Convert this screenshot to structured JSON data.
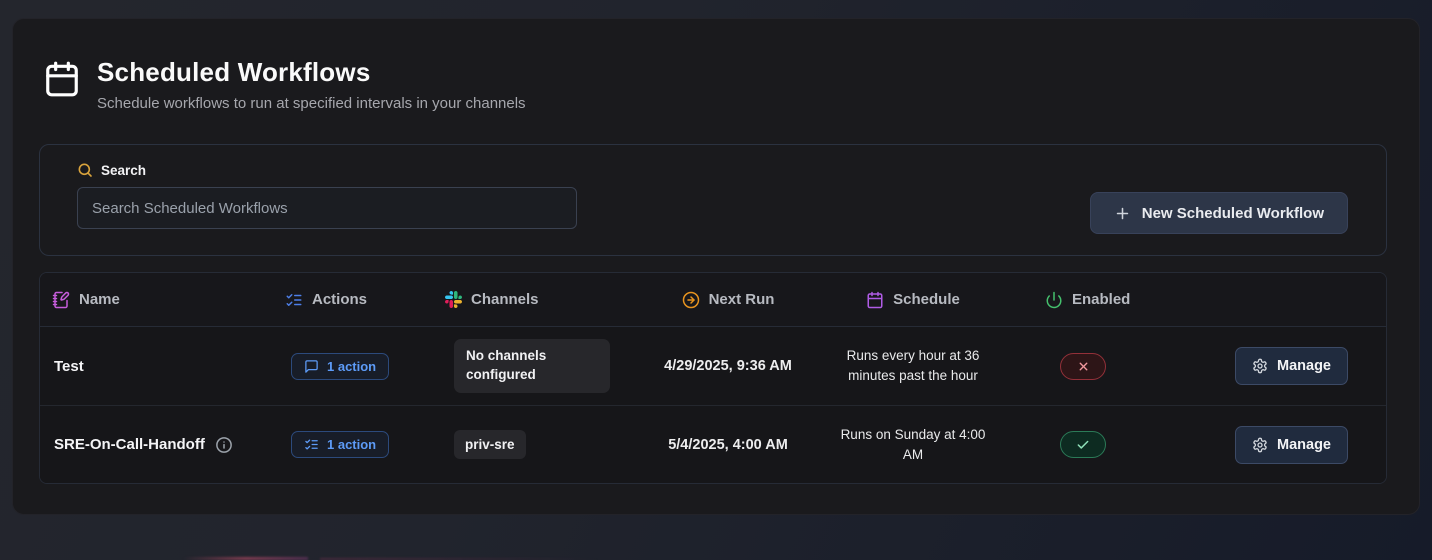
{
  "header": {
    "title": "Scheduled Workflows",
    "subtitle": "Schedule workflows to run at specified intervals in your channels"
  },
  "toolbar": {
    "search_label": "Search",
    "search_placeholder": "Search Scheduled Workflows",
    "new_workflow_label": "New Scheduled Workflow"
  },
  "table": {
    "columns": [
      {
        "label": "Name",
        "icon": "notebook-pen-icon"
      },
      {
        "label": "Actions",
        "icon": "list-checks-icon"
      },
      {
        "label": "Channels",
        "icon": "slack-icon"
      },
      {
        "label": "Next Run",
        "icon": "arrow-right-circle-icon"
      },
      {
        "label": "Schedule",
        "icon": "calendar-icon"
      },
      {
        "label": "Enabled",
        "icon": "power-icon"
      }
    ],
    "rows": [
      {
        "name": "Test",
        "actions_label": "1 action",
        "actions_icon": "message-square-icon",
        "channels": "No channels configured",
        "next_run": "4/29/2025, 9:36 AM",
        "schedule": "Runs every hour at 36 minutes past the hour",
        "enabled": false,
        "manage_label": "Manage"
      },
      {
        "name": "SRE-On-Call-Handoff",
        "actions_label": "1 action",
        "actions_icon": "list-checks-icon",
        "channels": "priv-sre",
        "next_run": "5/4/2025, 4:00 AM",
        "schedule": "Runs on Sunday at 4:00 AM",
        "enabled": true,
        "manage_label": "Manage"
      }
    ]
  },
  "colors": {
    "accent_blue": "#5d9bf7",
    "accent_purple_name": "#c65ddb",
    "accent_purple_schedule": "#b05ce6",
    "accent_orange": "#e8941f",
    "accent_green": "#45c06d",
    "accent_gold": "#d9a33c",
    "status_disabled": "#f0989e",
    "status_enabled": "#8fe0b9",
    "slack_blue": "#36C5F0",
    "slack_green": "#2EB67D",
    "slack_yellow": "#ECB22E",
    "slack_red": "#E01E5A"
  }
}
